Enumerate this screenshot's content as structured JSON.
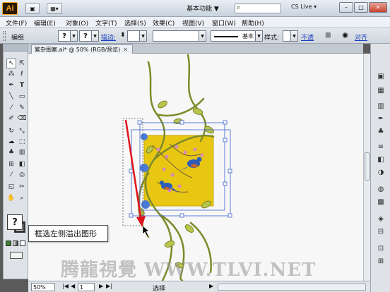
{
  "app": {
    "logo_text": "Ai",
    "workspace_label": "基本功能 ▼",
    "cs_live_label": "CS Live ▾",
    "window_controls": [
      "–",
      "□",
      "✕"
    ]
  },
  "menu": [
    "文件(F)",
    "编辑(E)",
    "对象(O)",
    "文字(T)",
    "选择(S)",
    "效果(C)",
    "视图(V)",
    "窗口(W)",
    "帮助(H)"
  ],
  "control_bar": {
    "mode_label": "编组",
    "fill_value": "?",
    "stroke_value": "?",
    "stroke_label": "描边:",
    "stroke_weight_arrow": "⬍",
    "brush_label": "基本",
    "style_label": "样式:",
    "opacity_link": "不透",
    "align_link": "对齐"
  },
  "document": {
    "tab_title": "繁杂图案.ai* @ 50% (RGB/预览)",
    "close_glyph": "✕"
  },
  "status": {
    "zoom": "50%",
    "page": "1",
    "tool_state": "选择"
  },
  "tooltip": {
    "help_glyph": "?",
    "text": "框选左侧溢出图形"
  },
  "watermark": "腾龍視覺 WWW.TLVI.NET",
  "colors": {
    "artwork_fill": "#e8c713",
    "vine_green": "#7d8a2a",
    "selection_blue": "#3a5fd0",
    "arrow_red": "#e0141c"
  },
  "icons": [
    "ai-logo-icon",
    "bridge-icon",
    "arrange-icon",
    "search-icon",
    "selection-tool-icon",
    "direct-selection-icon",
    "magic-wand-icon",
    "lasso-icon",
    "pen-icon",
    "type-icon",
    "line-icon",
    "rectangle-icon",
    "paintbrush-icon",
    "pencil-icon",
    "blob-brush-icon",
    "eraser-icon",
    "rotate-icon",
    "scale-icon",
    "warp-icon",
    "free-transform-icon",
    "symbol-sprayer-icon",
    "graph-icon",
    "mesh-icon",
    "gradient-icon",
    "eyedropper-icon",
    "blend-icon",
    "slice-icon",
    "scissors-icon",
    "hand-icon",
    "zoom-icon",
    "fill-icon",
    "stroke-icon"
  ]
}
